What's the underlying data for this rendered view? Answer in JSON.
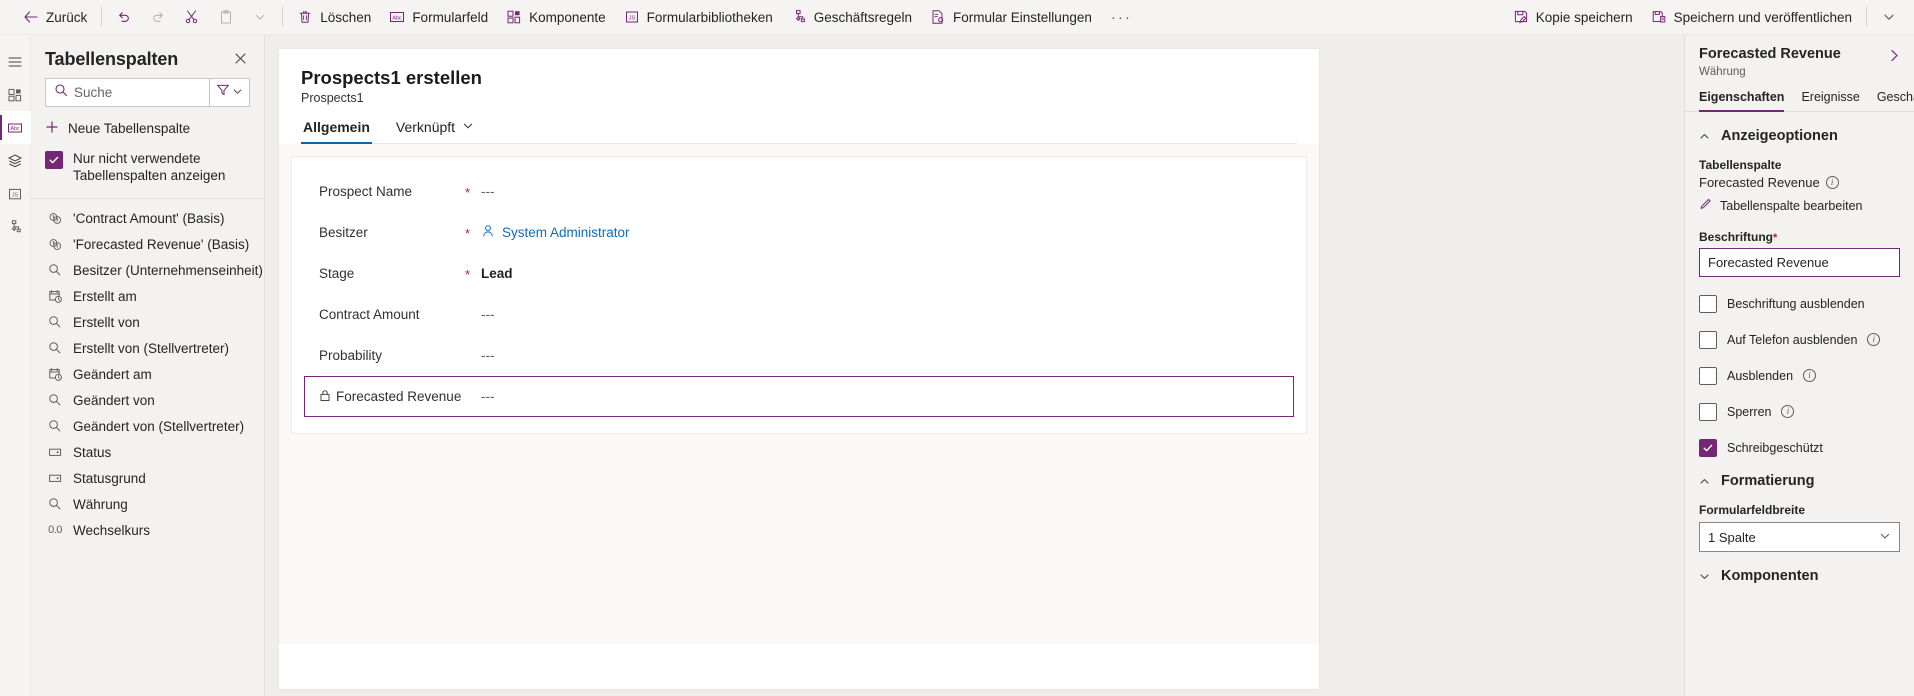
{
  "commandbar": {
    "back": {
      "label": "Zurück",
      "icon": "arrow-left-icon"
    },
    "undo": {
      "label": "",
      "icon": "undo-icon"
    },
    "redo": {
      "label": "",
      "icon": "redo-icon"
    },
    "cut": {
      "label": "",
      "icon": "scissors-icon"
    },
    "paste": {
      "label": "",
      "icon": "clipboard-icon"
    },
    "paste_chevron": {
      "label": "",
      "icon": "chevron-down-icon"
    },
    "items": [
      {
        "label": "Löschen",
        "icon": "trash-icon"
      },
      {
        "label": "Formularfeld",
        "icon": "abc-field-icon"
      },
      {
        "label": "Komponente",
        "icon": "component-icon"
      },
      {
        "label": "Formularbibliotheken",
        "icon": "js-library-icon"
      },
      {
        "label": "Geschäftsregeln",
        "icon": "business-rules-icon"
      },
      {
        "label": "Formular Einstellungen",
        "icon": "form-settings-icon"
      }
    ],
    "overflow": "···",
    "right_items": [
      {
        "label": "Kopie speichern",
        "icon": "save-copy-icon"
      },
      {
        "label": "Speichern und veröffentlichen",
        "icon": "save-publish-icon"
      }
    ],
    "right_chevron": {
      "label": "",
      "icon": "chevron-down-icon"
    }
  },
  "rail": {
    "items": [
      {
        "name": "hamburger-menu-icon"
      },
      {
        "name": "components-icon"
      },
      {
        "name": "abc-field-icon"
      },
      {
        "name": "layers-icon"
      },
      {
        "name": "js-library-icon"
      },
      {
        "name": "business-rules-icon"
      }
    ]
  },
  "leftpanel": {
    "title": "Tabellenspalten",
    "close_label": "✕",
    "search": {
      "placeholder": "Suche",
      "value": ""
    },
    "new_column_label": "Neue Tabellenspalte",
    "filter_checkbox": {
      "label": "Nur nicht verwendete Tabellenspalten anzeigen",
      "checked": true
    },
    "columns": [
      {
        "label": "'Contract Amount' (Basis)",
        "icon": "currency-icon"
      },
      {
        "label": "'Forecasted Revenue' (Basis)",
        "icon": "currency-icon"
      },
      {
        "label": "Besitzer (Unternehmenseinheit)",
        "icon": "lookup-icon"
      },
      {
        "label": "Erstellt am",
        "icon": "datetime-icon"
      },
      {
        "label": "Erstellt von",
        "icon": "lookup-icon"
      },
      {
        "label": "Erstellt von (Stellvertreter)",
        "icon": "lookup-icon"
      },
      {
        "label": "Geändert am",
        "icon": "datetime-icon"
      },
      {
        "label": "Geändert von",
        "icon": "lookup-icon"
      },
      {
        "label": "Geändert von (Stellvertreter)",
        "icon": "lookup-icon"
      },
      {
        "label": "Status",
        "icon": "choice-icon"
      },
      {
        "label": "Statusgrund",
        "icon": "choice-icon"
      },
      {
        "label": "Währung",
        "icon": "lookup-icon"
      },
      {
        "label": "Wechselkurs",
        "icon": "decimal-icon",
        "icon_text": "0.0"
      }
    ]
  },
  "form": {
    "title": "Prospects1 erstellen",
    "subtitle": "Prospects1",
    "tabs": [
      {
        "label": "Allgemein",
        "active": true,
        "has_chevron": false
      },
      {
        "label": "Verknüpft",
        "active": false,
        "has_chevron": true
      }
    ],
    "fields": [
      {
        "label": "Prospect Name",
        "required": true,
        "value": "---",
        "style": "empty",
        "selected": false,
        "locked": false
      },
      {
        "label": "Besitzer",
        "required": true,
        "value": "System Administrator",
        "style": "link",
        "selected": false,
        "locked": false,
        "icon": "person-icon"
      },
      {
        "label": "Stage",
        "required": true,
        "value": "Lead",
        "style": "bold",
        "selected": false,
        "locked": false
      },
      {
        "label": "Contract Amount",
        "required": false,
        "value": "---",
        "style": "empty",
        "selected": false,
        "locked": false
      },
      {
        "label": "Probability",
        "required": false,
        "value": "---",
        "style": "empty",
        "selected": false,
        "locked": false
      },
      {
        "label": "Forecasted Revenue",
        "required": false,
        "value": "---",
        "style": "empty",
        "selected": true,
        "locked": true,
        "icon": "lock-icon"
      }
    ]
  },
  "rightpanel": {
    "title": "Forecasted Revenue",
    "subtitle": "Währung",
    "expand_icon": "chevron-right-icon",
    "tabs": [
      {
        "label": "Eigenschaften",
        "active": true
      },
      {
        "label": "Ereignisse",
        "active": false
      },
      {
        "label": "Geschäft",
        "active": false
      }
    ],
    "display_options": {
      "group_title": "Anzeigeoptionen",
      "collapsed": false,
      "table_column_label": "Tabellenspalte",
      "table_column_value": "Forecasted Revenue",
      "edit_link": "Tabellenspalte bearbeiten",
      "label_field_label": "Beschriftung",
      "label_field_required": "*",
      "label_field_value": "Forecasted Revenue",
      "checkboxes": [
        {
          "label": "Beschriftung ausblenden",
          "checked": false,
          "info": false
        },
        {
          "label": "Auf Telefon ausblenden",
          "checked": false,
          "info": true
        },
        {
          "label": "Ausblenden",
          "checked": false,
          "info": true
        },
        {
          "label": "Sperren",
          "checked": false,
          "info": true
        },
        {
          "label": "Schreibgeschützt",
          "checked": true,
          "info": false
        }
      ]
    },
    "formatting": {
      "group_title": "Formatierung",
      "collapsed": false,
      "field_width_label": "Formularfeldbreite",
      "field_width_value": "1 Spalte"
    },
    "components": {
      "group_title": "Komponenten",
      "collapsed": true
    }
  },
  "colors": {
    "brand": "#742774",
    "link": "#0f6cbd",
    "tab_underline": "#1264a3",
    "required": "#a4262c"
  }
}
